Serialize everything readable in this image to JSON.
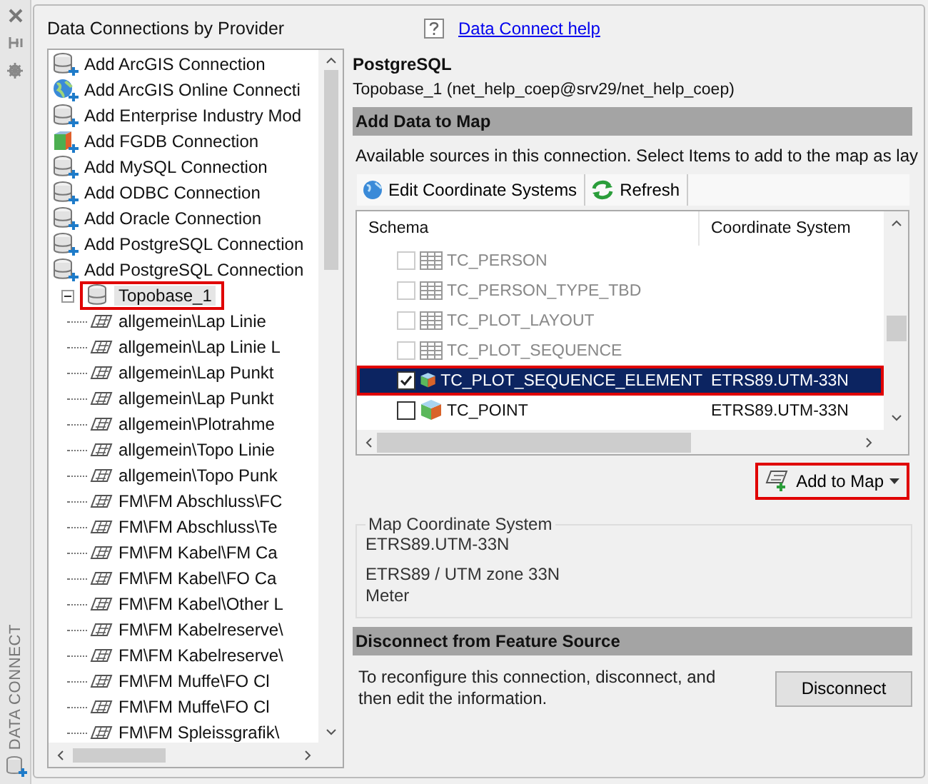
{
  "palette": {
    "title": "DATA CONNECT"
  },
  "providers": {
    "heading": "Data Connections by Provider",
    "items": [
      {
        "label": "Add ArcGIS Connection",
        "kind": "database"
      },
      {
        "label": "Add ArcGIS Online Connecti",
        "kind": "globe"
      },
      {
        "label": "Add Enterprise Industry Mod",
        "kind": "database"
      },
      {
        "label": "Add FGDB Connection",
        "kind": "cube"
      },
      {
        "label": "Add MySQL Connection",
        "kind": "database"
      },
      {
        "label": "Add ODBC Connection",
        "kind": "database"
      },
      {
        "label": "Add Oracle Connection",
        "kind": "database"
      },
      {
        "label": "Add PostgreSQL Connection",
        "kind": "database"
      },
      {
        "label": "Add PostgreSQL Connection",
        "kind": "database"
      }
    ],
    "connection": {
      "label": "Topobase_1",
      "expanded": true,
      "selected": true,
      "highlighted": true,
      "children": [
        "allgemein\\Lap Linie",
        "allgemein\\Lap Linie L",
        "allgemein\\Lap Punkt",
        "allgemein\\Lap Punkt",
        "allgemein\\Plotrahme",
        "allgemein\\Topo Linie",
        "allgemein\\Topo Punk",
        "FM\\FM Abschluss\\FC",
        "FM\\FM Abschluss\\Te",
        "FM\\FM Kabel\\FM Ca",
        "FM\\FM Kabel\\FO Ca",
        "FM\\FM Kabel\\Other L",
        "FM\\FM Kabelreserve\\",
        "FM\\FM Kabelreserve\\",
        "FM\\FM Muffe\\FO Cl",
        "FM\\FM Muffe\\FO Cl",
        "FM\\FM Spleissgrafik\\"
      ]
    }
  },
  "help_link": "Data Connect help",
  "provider_name": "PostgreSQL",
  "connection_info": "Topobase_1 (net_help_coep@srv29/net_help_coep)",
  "add_data": {
    "header": "Add Data to Map",
    "description": "Available sources in this connection.  Select Items to add to the map as lay",
    "toolbar": [
      "Edit Coordinate Systems",
      "Refresh"
    ],
    "columns": [
      "Schema",
      "Coordinate System"
    ],
    "rows": [
      {
        "name": "TC_PERSON",
        "kind": "table",
        "coordinate_system": "",
        "checked": false,
        "disabled": true,
        "selected": false,
        "highlighted": false
      },
      {
        "name": "TC_PERSON_TYPE_TBD",
        "kind": "table",
        "coordinate_system": "",
        "checked": false,
        "disabled": true,
        "selected": false,
        "highlighted": false
      },
      {
        "name": "TC_PLOT_LAYOUT",
        "kind": "table",
        "coordinate_system": "",
        "checked": false,
        "disabled": true,
        "selected": false,
        "highlighted": false
      },
      {
        "name": "TC_PLOT_SEQUENCE",
        "kind": "table",
        "coordinate_system": "",
        "checked": false,
        "disabled": true,
        "selected": false,
        "highlighted": false
      },
      {
        "name": "TC_PLOT_SEQUENCE_ELEMENT",
        "kind": "feature",
        "coordinate_system": "ETRS89.UTM-33N",
        "checked": true,
        "disabled": false,
        "selected": true,
        "highlighted": true
      },
      {
        "name": "TC_POINT",
        "kind": "feature",
        "coordinate_system": "ETRS89.UTM-33N",
        "checked": false,
        "disabled": false,
        "selected": false,
        "highlighted": false
      }
    ],
    "add_button": {
      "label": "Add to Map",
      "highlighted": true
    }
  },
  "map_cs": {
    "legend": "Map Coordinate System",
    "lines": [
      "ETRS89.UTM-33N",
      "ETRS89 / UTM zone 33N",
      "Meter"
    ]
  },
  "disconnect": {
    "header": "Disconnect from Feature Source",
    "text": "To reconfigure this connection, disconnect, and then edit the information.",
    "button": "Disconnect"
  }
}
